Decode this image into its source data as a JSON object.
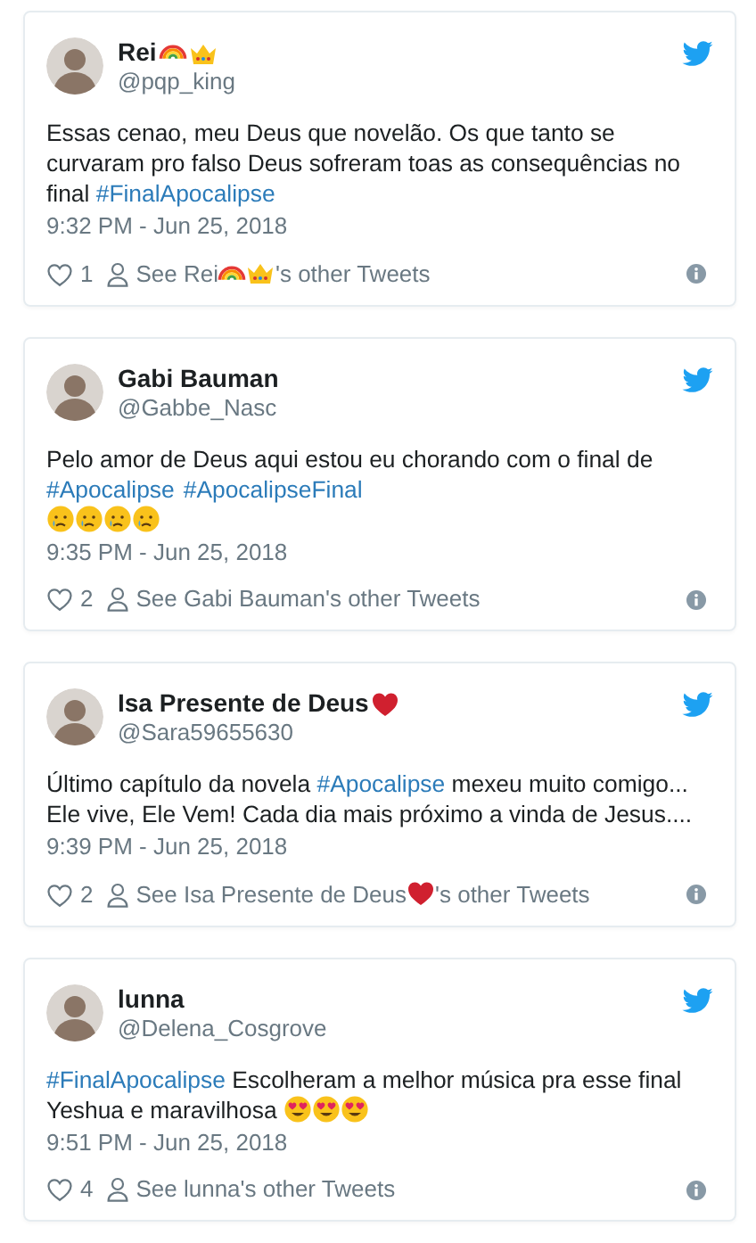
{
  "tweets": [
    {
      "name": [
        {
          "kind": "text",
          "text": "Rei"
        },
        {
          "kind": "rainbow"
        },
        {
          "kind": "crown"
        }
      ],
      "handle": "@pqp_king",
      "body": [
        {
          "kind": "text",
          "text": "Essas cenao, meu Deus que novelão. Os que tanto se curvaram pro falso Deus sofreram toas as consequências no final "
        },
        {
          "kind": "hashtag",
          "text": "#FinalApocalipse"
        }
      ],
      "time": "9:32 PM - Jun 25, 2018",
      "likes": "1",
      "link": [
        {
          "kind": "text",
          "text": "See Rei"
        },
        {
          "kind": "rainbow"
        },
        {
          "kind": "crown"
        },
        {
          "kind": "text",
          "text": "'s other Tweets"
        }
      ]
    },
    {
      "name": [
        {
          "kind": "text",
          "text": "Gabi Bauman"
        }
      ],
      "handle": "@Gabbe_Nasc",
      "body": [
        {
          "kind": "text",
          "text": "Pelo amor de Deus aqui estou eu chorando com o final de"
        },
        {
          "kind": "break"
        },
        {
          "kind": "hashtag",
          "text": "#Apocalipse"
        },
        {
          "kind": "hashtag",
          "text": "#ApocalipseFinal"
        },
        {
          "kind": "break"
        },
        {
          "kind": "crying"
        },
        {
          "kind": "crying"
        },
        {
          "kind": "crying"
        },
        {
          "kind": "crying"
        }
      ],
      "time": "9:35 PM - Jun 25, 2018",
      "likes": "2",
      "link": [
        {
          "kind": "text",
          "text": "See Gabi Bauman's other Tweets"
        }
      ]
    },
    {
      "name": [
        {
          "kind": "text",
          "text": "Isa Presente de Deus"
        },
        {
          "kind": "heart"
        }
      ],
      "handle": "@Sara59655630",
      "body": [
        {
          "kind": "text",
          "text": "Último capítulo da novela "
        },
        {
          "kind": "hashtag",
          "text": "#Apocalipse"
        },
        {
          "kind": "text",
          "text": " mexeu muito comigo... Ele vive, Ele Vem! Cada dia mais próximo a vinda de Jesus...."
        }
      ],
      "time": "9:39 PM - Jun 25, 2018",
      "likes": "2",
      "link": [
        {
          "kind": "text",
          "text": "See Isa Presente de Deus"
        },
        {
          "kind": "heart"
        },
        {
          "kind": "text",
          "text": "'s other Tweets"
        }
      ]
    },
    {
      "name": [
        {
          "kind": "text",
          "text": "lunna"
        }
      ],
      "handle": "@Delena_Cosgrove",
      "body": [
        {
          "kind": "hashtag",
          "text": "#FinalApocalipse"
        },
        {
          "kind": "text",
          "text": " Escolheram a melhor música pra esse final Yeshua e maravilhosa "
        },
        {
          "kind": "hearteyes"
        },
        {
          "kind": "hearteyes"
        },
        {
          "kind": "hearteyes"
        }
      ],
      "time": "9:51 PM - Jun 25, 2018",
      "likes": "4",
      "link": [
        {
          "kind": "text",
          "text": "See lunna's other Tweets"
        }
      ]
    }
  ]
}
